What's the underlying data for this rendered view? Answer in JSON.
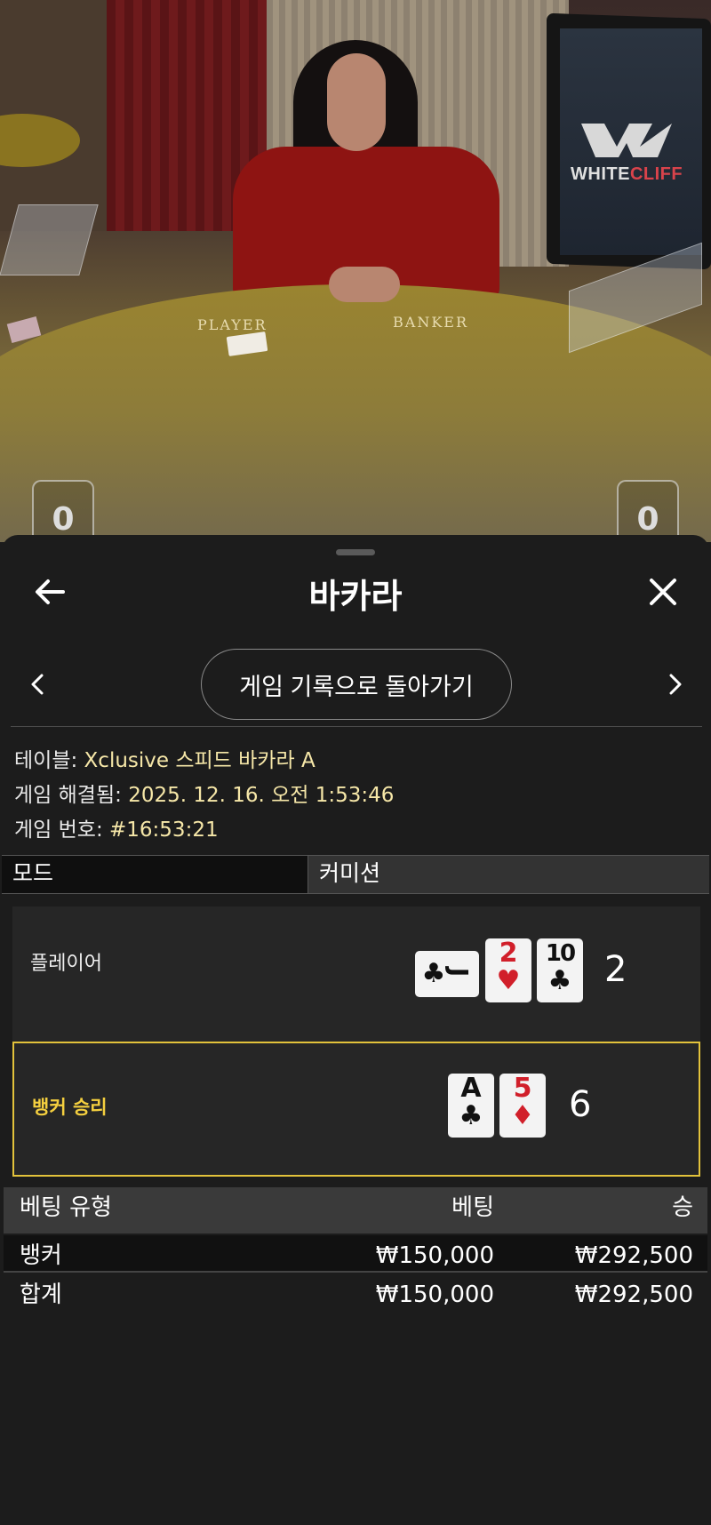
{
  "video": {
    "table_labels": {
      "player": "PLAYER",
      "banker": "BANKER"
    },
    "logo_text": {
      "part1": "WHITE",
      "part2": "CLIFF"
    },
    "score_left": "0",
    "score_right": "0"
  },
  "header": {
    "title": "바카라",
    "back_icon": "arrow-left-icon",
    "close_icon": "close-icon"
  },
  "history": {
    "back_to_history_label": "게임 기록으로 돌아가기",
    "prev_icon": "chevron-left-icon",
    "next_icon": "chevron-right-icon"
  },
  "info": {
    "table_label": "테이블:",
    "table_value": "Xclusive 스피드 바카라 A",
    "resolved_label": "게임 해결됨:",
    "resolved_value": "2025. 12. 16. 오전 1:53:46",
    "game_no_label": "게임 번호:",
    "game_no_value": "#16:53:21"
  },
  "tabs": {
    "mode": "모드",
    "commission": "커미션"
  },
  "results": {
    "player": {
      "label": "플레이어",
      "cards": [
        {
          "rank": "J",
          "suit": "♣",
          "color": "#111111",
          "orientation": "sideways"
        },
        {
          "rank": "2",
          "suit": "♥",
          "color": "#d11f2a"
        },
        {
          "rank": "10",
          "suit": "♣",
          "color": "#111111"
        }
      ],
      "total": "2"
    },
    "banker": {
      "label": "뱅커 승리",
      "cards": [
        {
          "rank": "A",
          "suit": "♣",
          "color": "#111111"
        },
        {
          "rank": "5",
          "suit": "♦",
          "color": "#d11f2a"
        }
      ],
      "total": "6",
      "highlight_color": "#e2c23b"
    }
  },
  "bets": {
    "columns": {
      "type": "베팅 유형",
      "bet": "베팅",
      "win": "승"
    },
    "rows": [
      {
        "type": "뱅커",
        "bet": "₩150,000",
        "win": "₩292,500"
      }
    ],
    "total": {
      "type": "합계",
      "bet": "₩150,000",
      "win": "₩292,500"
    }
  }
}
